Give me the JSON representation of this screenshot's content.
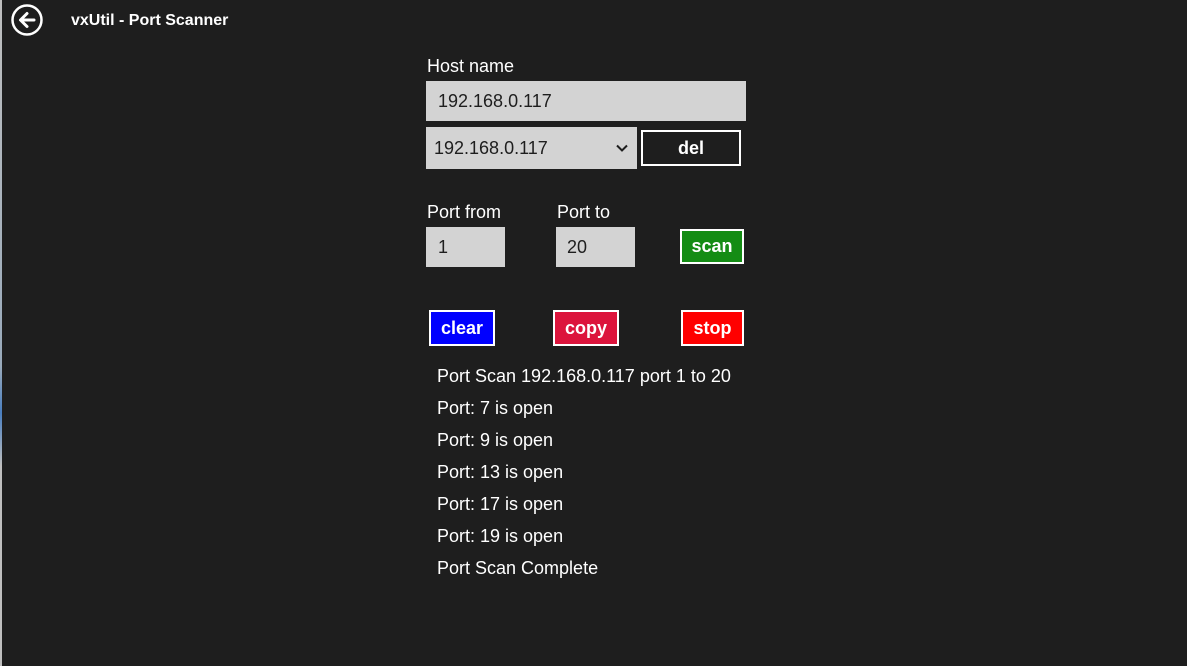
{
  "window": {
    "title": "vxUtil - Port Scanner",
    "back_icon": "back-arrow-icon"
  },
  "form": {
    "host_label": "Host name",
    "host_value": "192.168.0.117",
    "history_selected": "192.168.0.117",
    "history_chevron_icon": "chevron-down-icon",
    "del_label": "del",
    "port_from_label": "Port from",
    "port_from_value": "1",
    "port_to_label": "Port to",
    "port_to_value": "20",
    "scan_label": "scan"
  },
  "actions": {
    "clear_label": "clear",
    "copy_label": "copy",
    "stop_label": "stop"
  },
  "colors": {
    "background": "#1e1e1e",
    "input_bg": "#d3d3d3",
    "scan_bg": "#148c14",
    "clear_bg": "#0000ff",
    "copy_bg": "#dc143c",
    "stop_bg": "#ff0000"
  },
  "output": [
    "Port Scan  192.168.0.117 port 1 to 20",
    "Port: 7 is open",
    "Port: 9 is open",
    "Port: 13 is open",
    "Port: 17 is open",
    "Port: 19 is open",
    "Port Scan Complete"
  ]
}
